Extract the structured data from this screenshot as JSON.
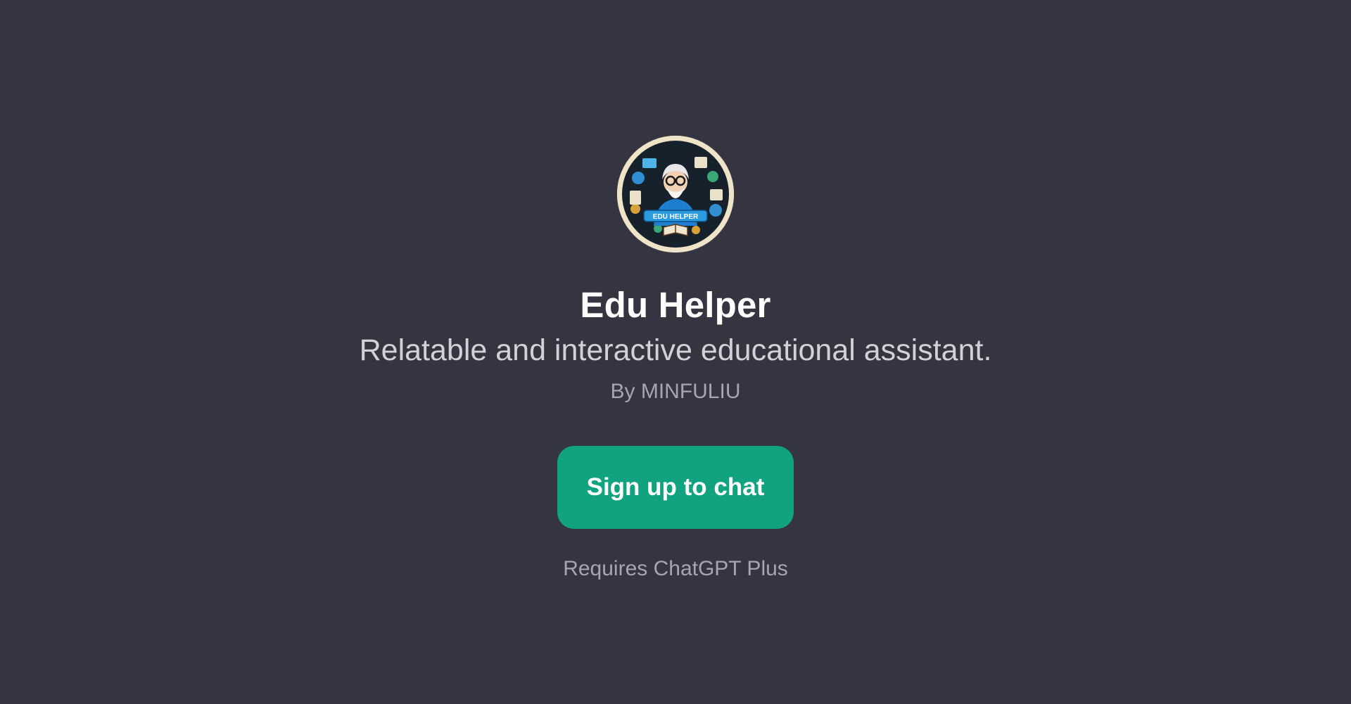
{
  "gpt": {
    "name": "Edu Helper",
    "description": "Relatable and interactive educational assistant.",
    "author": "By MINFULIU",
    "avatar_label": "EDU HELPER",
    "avatar_icon": "wizard-teacher-emblem"
  },
  "cta": {
    "label": "Sign up to chat"
  },
  "footer": {
    "requirement": "Requires ChatGPT Plus"
  },
  "colors": {
    "background": "#343541",
    "accent": "#11a37f",
    "title": "#ffffff",
    "subtitle": "#d1d1da",
    "muted": "#a6a6b2"
  }
}
